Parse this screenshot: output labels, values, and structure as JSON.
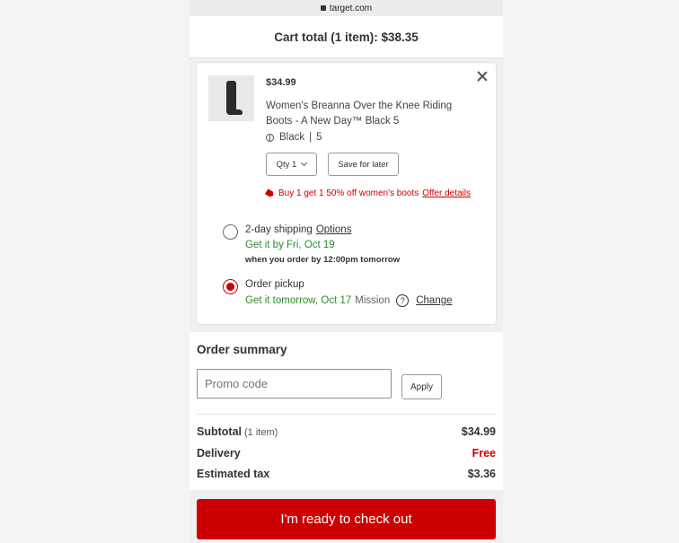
{
  "browser": {
    "url": "target.com"
  },
  "header": {
    "title": "Cart total (1 item): $38.35"
  },
  "item": {
    "price": "$34.99",
    "title": "Women's Breanna Over the Knee Riding Boots - A New Day™ Black 5",
    "color": "Black",
    "size": "5",
    "qty_label": "Qty 1",
    "save_label": "Save for later",
    "promo_text": "Buy 1 get 1 50% off women's boots",
    "promo_link": "Offer details"
  },
  "fulfillment": {
    "shipping": {
      "label": "2-day shipping",
      "options_link": "Options",
      "eta": "Get it by Fri, Oct 19",
      "cutoff": "when you order by 12:00pm tomorrow",
      "selected": false
    },
    "pickup": {
      "label": "Order pickup",
      "eta": "Get it tomorrow, Oct 17",
      "store": "Mission",
      "change_link": "Change",
      "selected": true
    }
  },
  "summary": {
    "heading": "Order summary",
    "promo_placeholder": "Promo code",
    "apply_label": "Apply",
    "subtotal_label": "Subtotal",
    "subtotal_count": "(1 item)",
    "subtotal_value": "$34.99",
    "delivery_label": "Delivery",
    "delivery_value": "Free",
    "tax_label": "Estimated tax",
    "tax_value": "$3.36"
  },
  "checkout": {
    "label": "I'm ready to check out"
  },
  "colors": {
    "accent": "#cc0000",
    "success": "#2d8c2d"
  }
}
